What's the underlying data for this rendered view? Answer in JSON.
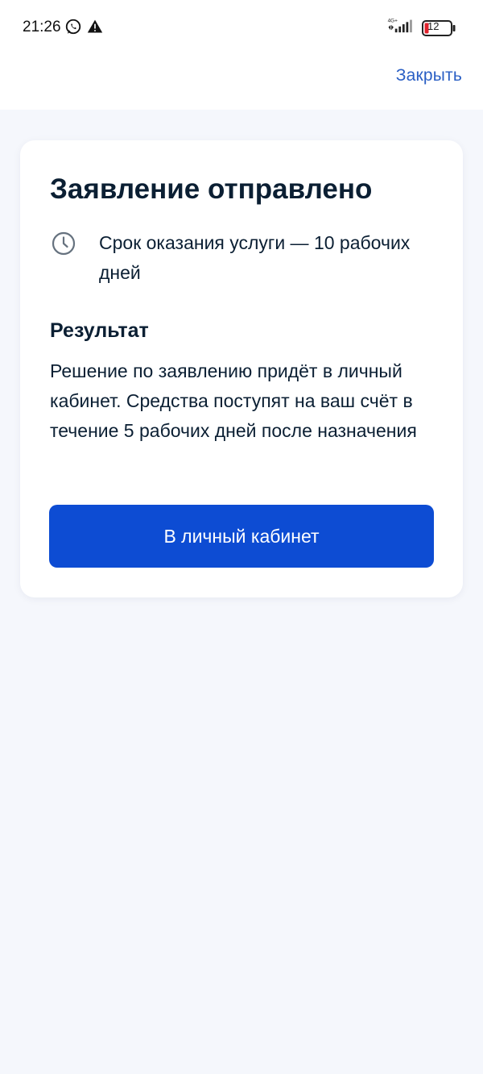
{
  "status_bar": {
    "time": "21:26",
    "battery": "12",
    "network_label": "4G+"
  },
  "header": {
    "close_label": "Закрыть"
  },
  "card": {
    "title": "Заявление отправлено",
    "deadline": "Срок оказания услуги — 10 рабочих дней",
    "result_heading": "Результат",
    "result_text": "Решение по заявлению придёт в личный кабинет. Средства поступят на ваш счёт в течение 5 рабочих дней после назначения",
    "button_label": "В личный кабинет"
  },
  "colors": {
    "accent": "#0d4cd3",
    "background": "#f5f7fc",
    "text": "#0b1f33",
    "battery_low": "#e0222c"
  },
  "icons": [
    "whatsapp-icon",
    "warning-icon",
    "signal-icon",
    "battery-icon",
    "clock-icon"
  ]
}
